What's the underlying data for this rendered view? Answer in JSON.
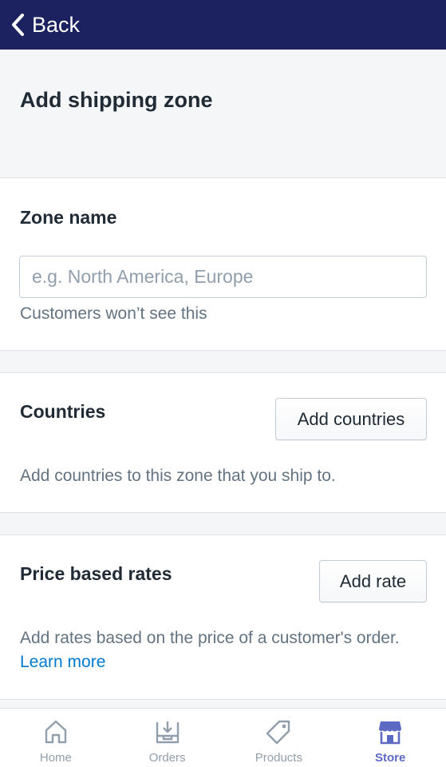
{
  "topbar": {
    "back_label": "Back"
  },
  "page": {
    "title": "Add shipping zone"
  },
  "zone": {
    "title": "Zone name",
    "placeholder": "e.g. North America, Europe",
    "value": "",
    "helper": "Customers won’t see this"
  },
  "countries": {
    "title": "Countries",
    "button_label": "Add countries",
    "helper": "Add countries to this zone that you ship to."
  },
  "rates": {
    "title": "Price based rates",
    "button_label": "Add rate",
    "helper": "Add rates based on the price of a customer's order.",
    "link_label": "Learn more"
  },
  "tabs": [
    {
      "label": "Home",
      "icon": "home-icon",
      "active": false
    },
    {
      "label": "Orders",
      "icon": "orders-icon",
      "active": false
    },
    {
      "label": "Products",
      "icon": "tag-icon",
      "active": false
    },
    {
      "label": "Store",
      "icon": "store-icon",
      "active": true
    }
  ],
  "colors": {
    "topbar": "#1c2260",
    "accent": "#5c6ac4",
    "link": "#007ace",
    "inactive_tab": "#919eab"
  }
}
